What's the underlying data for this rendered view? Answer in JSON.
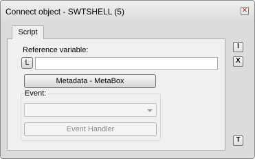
{
  "window": {
    "title": "Connect object - SWTSHELL (5)",
    "close_glyph": "✕"
  },
  "tabs": [
    {
      "label": "Script",
      "selected": true
    }
  ],
  "reference": {
    "label": "Reference variable:",
    "l_button": "L",
    "value": ""
  },
  "metadata_button": "Metadata - MetaBox",
  "event": {
    "label": "Event:",
    "selected_value": "",
    "handler_button": "Event Handler"
  },
  "side_buttons": {
    "i_label": "I",
    "x_label": "X",
    "t_label": "T"
  }
}
